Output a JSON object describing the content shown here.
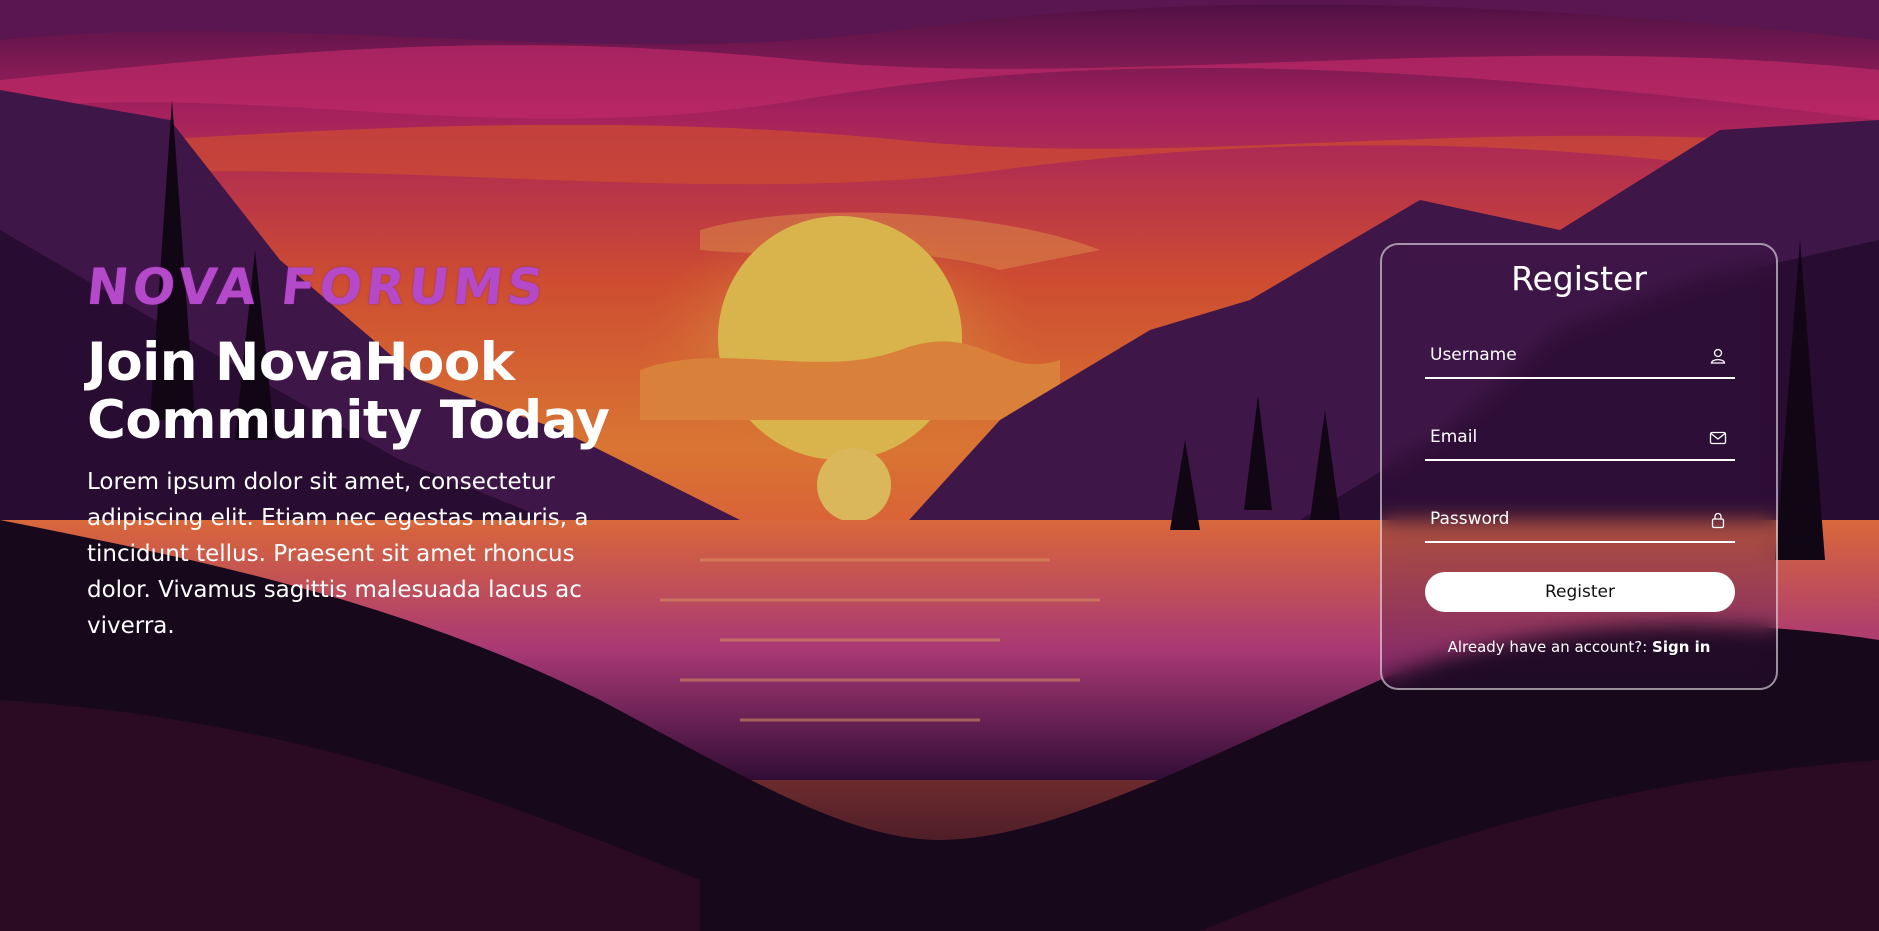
{
  "brand": {
    "logo_text": "NOVA FORUMS",
    "accent": "#b449c9"
  },
  "hero": {
    "headline_line1": "Join NovaHook",
    "headline_line2": "Community Today",
    "description": "Lorem ipsum dolor sit amet, consectetur adipiscing elit. Etiam nec egestas mauris, a tincidunt tellus. Praesent sit amet rhoncus dolor. Vivamus sagittis malesuada lacus ac viverra."
  },
  "register": {
    "title": "Register",
    "username_placeholder": "Username",
    "email_placeholder": "Email",
    "password_placeholder": "Password",
    "submit_label": "Register",
    "already_text": "Already have an account?: ",
    "signin_label": "Sign in",
    "icons": {
      "username": "user-icon",
      "email": "mail-icon",
      "password": "lock-icon"
    }
  }
}
